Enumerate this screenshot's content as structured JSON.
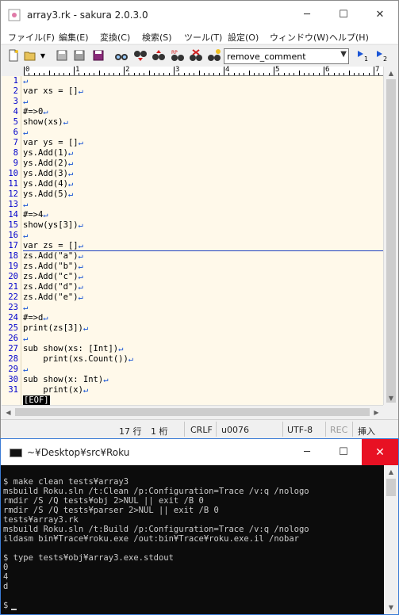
{
  "editor_window": {
    "title": "array3.rk - sakura 2.0.3.0",
    "controls": {
      "minimize": "─",
      "maximize": "☐",
      "close": "✕"
    },
    "menu": [
      "ファイル(F)",
      "編集(E)",
      "変換(C)",
      "検索(S)",
      "ツール(T)",
      "設定(O)",
      "ウィンドウ(W)",
      "ヘルプ(H)"
    ],
    "toolbar": {
      "search_combo_value": "remove_comment",
      "nav_labels": [
        "1",
        "2"
      ]
    },
    "ruler_numbers": [
      "0",
      "1",
      "2",
      "3",
      "4",
      "5",
      "6",
      "7"
    ],
    "line_numbers": [
      "1",
      "2",
      "3",
      "4",
      "5",
      "6",
      "7",
      "8",
      "9",
      "10",
      "11",
      "12",
      "13",
      "14",
      "15",
      "16",
      "17",
      "18",
      "19",
      "20",
      "21",
      "22",
      "23",
      "24",
      "25",
      "26",
      "27",
      "28",
      "29",
      "30",
      "31"
    ],
    "code_lines": [
      "",
      "var xs = []",
      "",
      "#=>0",
      "show(xs)",
      "",
      "var ys = []",
      "ys.Add(1)",
      "ys.Add(2)",
      "ys.Add(3)",
      "ys.Add(4)",
      "ys.Add(5)",
      "",
      "#=>4",
      "show(ys[3])",
      "",
      "var zs = []",
      "zs.Add(\"a\")",
      "zs.Add(\"b\")",
      "zs.Add(\"c\")",
      "zs.Add(\"d\")",
      "zs.Add(\"e\")",
      "",
      "#=>d",
      "print(zs[3])",
      "",
      "sub show(xs: [Int])",
      "    print(xs.Count())",
      "",
      "sub show(x: Int)",
      "    print(x)"
    ],
    "eof_marker": "[EOF]",
    "status": {
      "line": "17 行",
      "column": "1 桁",
      "newline": "CRLF",
      "charcode": "u0076",
      "encoding": "UTF-8",
      "rec": "REC",
      "mode": "挿入"
    }
  },
  "console_window": {
    "title": "~¥Desktop¥src¥Roku",
    "controls": {
      "minimize": "─",
      "maximize": "☐",
      "close": "✕"
    },
    "lines": [
      "",
      "$ make clean tests¥array3",
      "msbuild Roku.sln /t:Clean /p:Configuration=Trace /v:q /nologo",
      "rmdir /S /Q tests¥obj 2>NUL || exit /B 0",
      "rmdir /S /Q tests¥parser 2>NUL || exit /B 0",
      "tests¥array3.rk",
      "msbuild Roku.sln /t:Build /p:Configuration=Trace /v:q /nologo",
      "ildasm bin¥Trace¥roku.exe /out:bin¥Trace¥roku.exe.il /nobar",
      "",
      "$ type tests¥obj¥array3.exe.stdout",
      "0",
      "4",
      "d",
      "",
      "$"
    ]
  }
}
